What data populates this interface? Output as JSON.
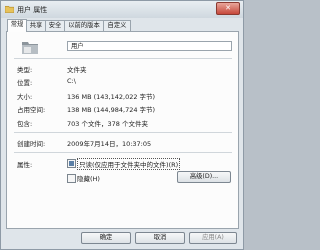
{
  "window": {
    "title": "用户 属性",
    "close_glyph": "✕"
  },
  "tabs": [
    {
      "label": "常规",
      "active": true
    },
    {
      "label": "共享",
      "active": false
    },
    {
      "label": "安全",
      "active": false
    },
    {
      "label": "以前的版本",
      "active": false
    },
    {
      "label": "自定义",
      "active": false
    }
  ],
  "general": {
    "folder_name": "用户",
    "type_label": "类型:",
    "type_value": "文件夹",
    "location_label": "位置:",
    "location_value": "C:\\",
    "size_label": "大小:",
    "size_value": "136 MB (143,142,022 字节)",
    "size_on_disk_label": "占用空间:",
    "size_on_disk_value": "138 MB (144,984,724 字节)",
    "contains_label": "包含:",
    "contains_value": "703 个文件，378 个文件夹",
    "created_label": "创建时间:",
    "created_value": "2009年7月14日，10:37:05",
    "attributes_label": "属性:",
    "readonly_label": "只读(仅应用于文件夹中的文件)(R)",
    "hidden_label": "隐藏(H)",
    "advanced_label": "高级(D)..."
  },
  "footer": {
    "ok_label": "确定",
    "cancel_label": "取消",
    "apply_label": "应用(A)"
  },
  "colors": {
    "accent": "#5b7fa6",
    "close": "#c6483b"
  },
  "icons": [
    "folder-icon",
    "close-icon"
  ]
}
